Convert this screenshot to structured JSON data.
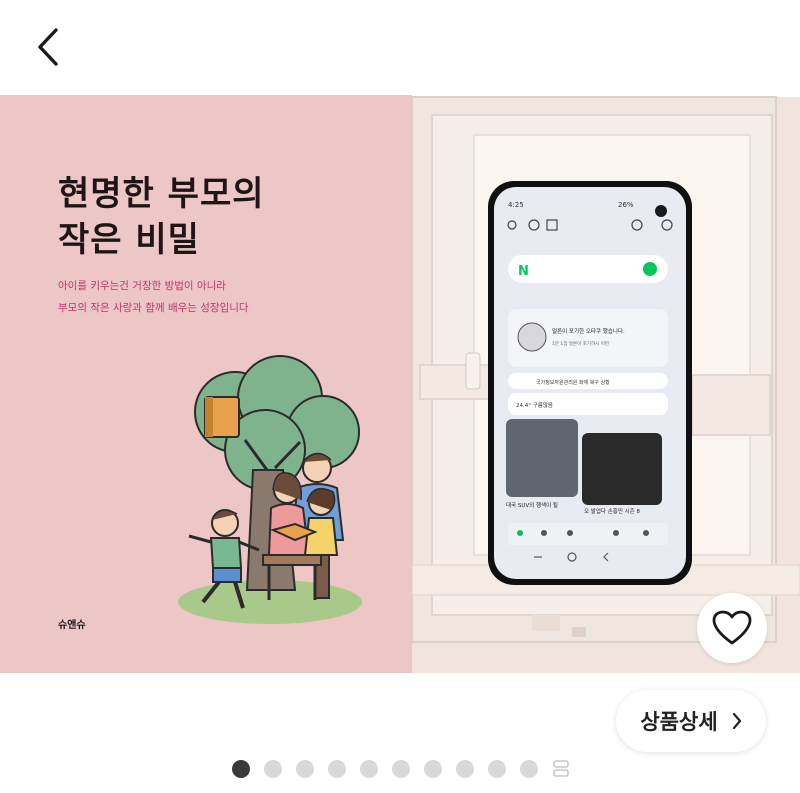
{
  "header": {
    "back_icon": "chevron-left-icon"
  },
  "cover": {
    "title": "현명한 부모의\n작은 비밀",
    "subtitle": "아이를 키우는건 거창한 방법이 아니라\n부모의 작은 사랑과 함께 배우는 성장입니다",
    "publisher": "슈앤슈",
    "background_color": "#edc6c6",
    "subtitle_color": "#c0356c"
  },
  "phone_screen": {
    "status_time": "4:25",
    "status_battery": "26%",
    "card_title": "얼른이 포기한 오타쿠 했습니다.",
    "card_sub": "1분 1집 얼른이 포기하시 어떤",
    "notice": "국가정보자원관리원 화재 복구 상황",
    "weather": "24.4° 구름많음",
    "news1": "대국 SUV의 행색이 될",
    "news2": "오 발업다 손흥민 시즌 8"
  },
  "actions": {
    "like_icon": "heart-outline-icon",
    "detail_label": "상품상세",
    "detail_icon": "chevron-right-icon"
  },
  "pager": {
    "total_dots": 10,
    "active_index": 0,
    "more_icon": "grid-more-icon"
  }
}
